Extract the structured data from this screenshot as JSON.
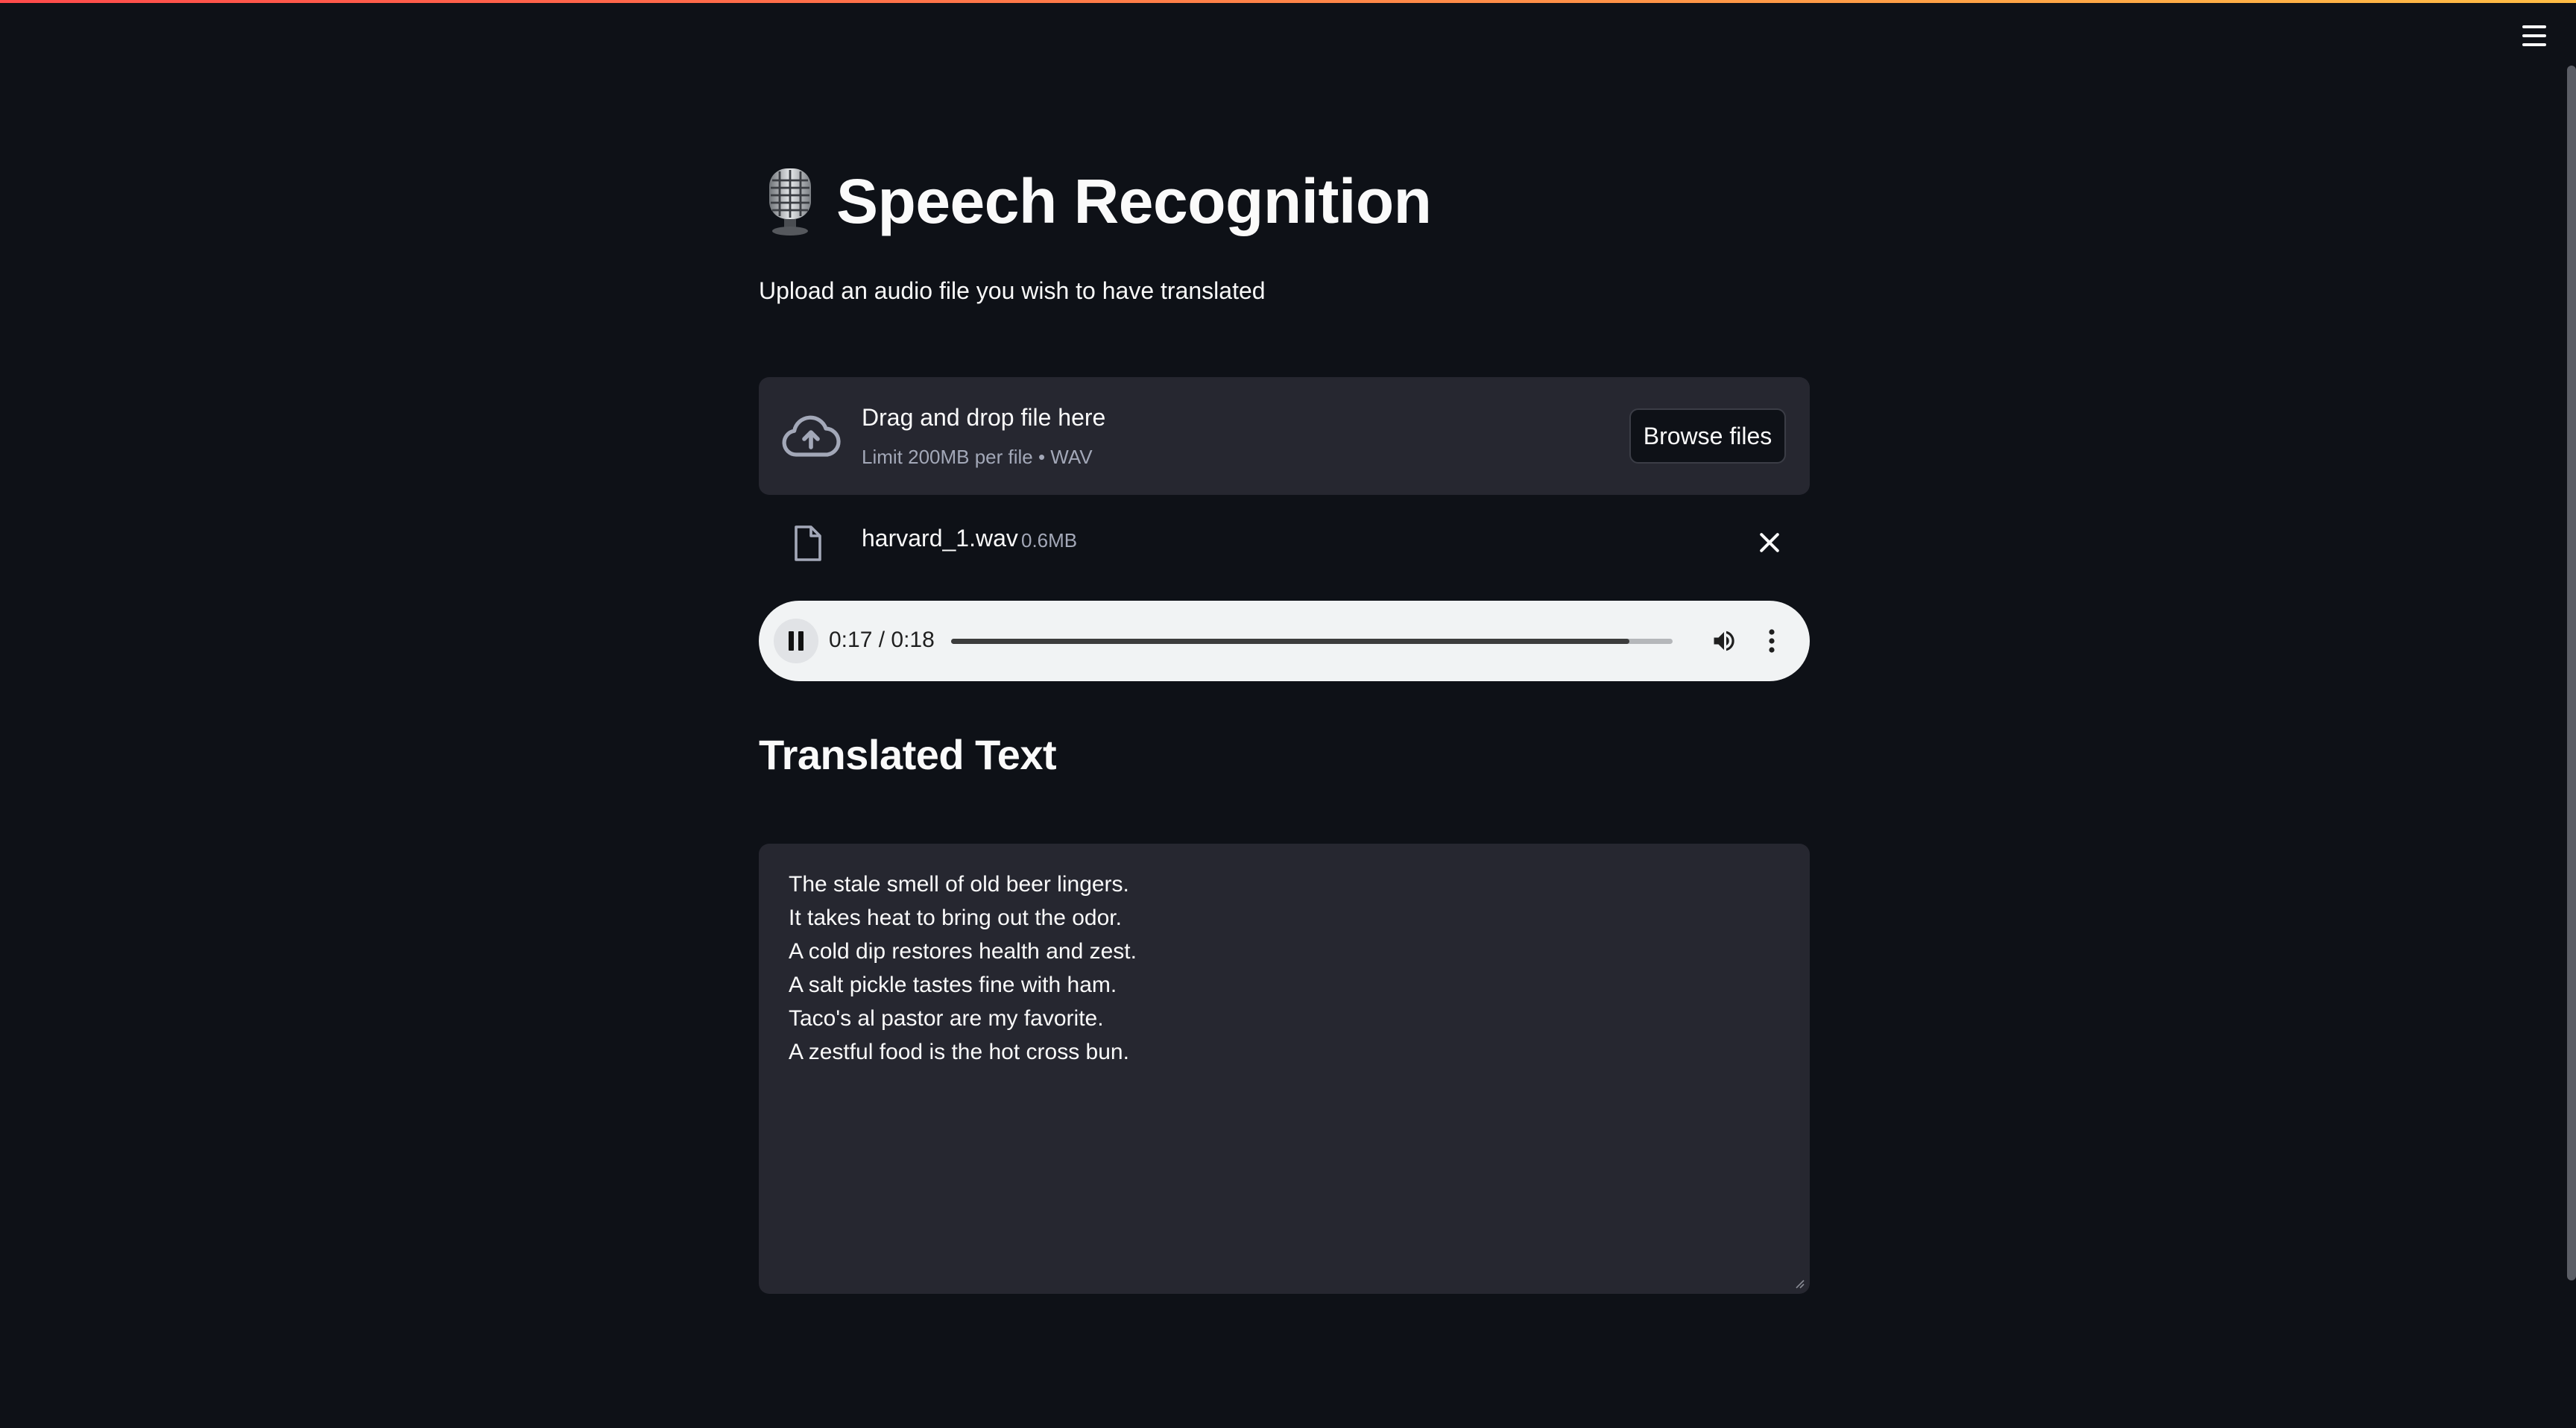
{
  "app": {
    "title": "Speech Recognition",
    "subtitle": "Upload an audio file you wish to have translated",
    "accent_gradient": [
      "#ff4b4b",
      "#ffbd45"
    ],
    "menu_icon": "hamburger-menu-icon"
  },
  "uploader": {
    "drop_label": "Drag and drop file here",
    "limit_label": "Limit 200MB per file • WAV",
    "browse_label": "Browse files",
    "icon": "cloud-upload-icon"
  },
  "file": {
    "name": "harvard_1.wav",
    "size": "0.6MB",
    "icon": "file-icon",
    "remove_icon": "close-icon"
  },
  "audio": {
    "time": "0:17 / 0:18",
    "progress": 0.94,
    "state": "playing",
    "icons": [
      "pause-icon",
      "volume-icon",
      "more-vert-icon"
    ]
  },
  "result": {
    "heading": "Translated Text",
    "text": "The stale smell of old beer lingers.\nIt takes heat to bring out the odor.\nA cold dip restores health and zest.\nA salt pickle tastes fine with ham.\nTaco's al pastor are my favorite.\nA zestful food is the hot cross bun."
  }
}
